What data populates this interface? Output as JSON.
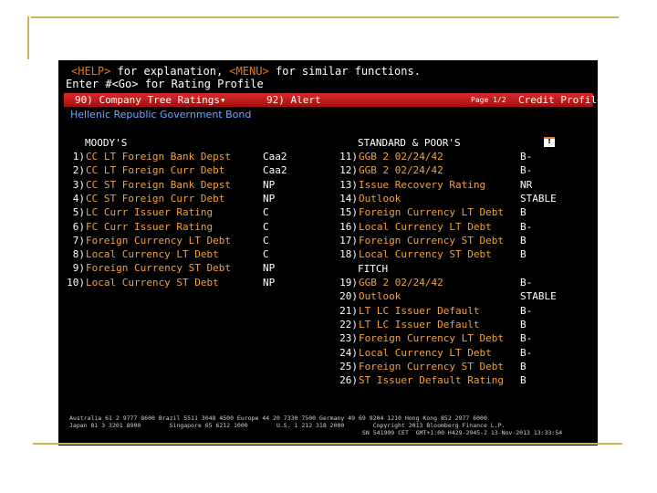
{
  "command": {
    "help_key": "<HELP>",
    "help_text": " for explanation, ",
    "menu_key": "<MENU>",
    "menu_text": " for similar functions.",
    "prompt": "Enter #<Go> for Rating Profile"
  },
  "toolbar": {
    "company_tree": "90) Company Tree Ratings▾",
    "alert": "92) Alert",
    "page": "Page 1/2",
    "title": "Credit Profile"
  },
  "security_name": "Hellenic Republic Government Bond",
  "moodys": {
    "header": "MOODY'S",
    "rows": [
      {
        "num": "1)",
        "label": "CC LT Foreign Bank Depst",
        "value": "Caa2"
      },
      {
        "num": "2)",
        "label": "CC LT Foreign Curr Debt",
        "value": "Caa2"
      },
      {
        "num": "3)",
        "label": "CC ST Foreign Bank Depst",
        "value": "NP"
      },
      {
        "num": "4)",
        "label": "CC ST Foreign Curr Debt",
        "value": "NP"
      },
      {
        "num": "5)",
        "label": "LC Curr Issuer Rating",
        "value": "C"
      },
      {
        "num": "6)",
        "label": "FC Curr Issuer Rating",
        "value": "C"
      },
      {
        "num": "7)",
        "label": "Foreign Currency LT Debt",
        "value": "C"
      },
      {
        "num": "8)",
        "label": "Local Currency LT Debt",
        "value": "C"
      },
      {
        "num": "9)",
        "label": "Foreign Currency ST Debt",
        "value": "NP"
      },
      {
        "num": "10)",
        "label": "Local Currency ST Debt",
        "value": "NP"
      }
    ]
  },
  "sp": {
    "header": "STANDARD & POOR'S",
    "rows": [
      {
        "num": "11)",
        "label": "GGB 2 02/24/42",
        "value": "B-"
      },
      {
        "num": "12)",
        "label": "GGB 2 02/24/42",
        "value": "B-"
      },
      {
        "num": "13)",
        "label": "Issue Recovery Rating",
        "value": "NR"
      },
      {
        "num": "14)",
        "label": "Outlook",
        "value": "STABLE"
      },
      {
        "num": "15)",
        "label": "Foreign Currency LT Debt",
        "value": "B"
      },
      {
        "num": "16)",
        "label": "Local Currency LT Debt",
        "value": "B-"
      },
      {
        "num": "17)",
        "label": "Foreign Currency ST Debt",
        "value": "B"
      },
      {
        "num": "18)",
        "label": "Local Currency ST Debt",
        "value": "B"
      }
    ]
  },
  "fitch": {
    "header": "FITCH",
    "rows": [
      {
        "num": "19)",
        "label": "GGB 2 02/24/42",
        "value": "B-"
      },
      {
        "num": "20)",
        "label": "Outlook",
        "value": "STABLE"
      },
      {
        "num": "21)",
        "label": "LT LC Issuer Default",
        "value": "B-"
      },
      {
        "num": "22)",
        "label": "LT LC Issuer Default",
        "value": "B"
      },
      {
        "num": "23)",
        "label": "Foreign Currency LT Debt",
        "value": "B-"
      },
      {
        "num": "24)",
        "label": "Local Currency LT Debt",
        "value": "B-"
      },
      {
        "num": "25)",
        "label": "Foreign Currency ST Debt",
        "value": "B"
      },
      {
        "num": "26)",
        "label": "ST Issuer Default Rating",
        "value": "B"
      }
    ]
  },
  "help_icon": "!",
  "footer": {
    "line1": "Australia 61 2 9777 8600 Brazil 5511 3048 4500 Europe 44 20 7330 7500 Germany 49 69 9204 1210 Hong Kong 852 2977 6000",
    "line2": "Japan 81 3 3201 8900        Singapore 65 6212 1000        U.S. 1 212 318 2000        Copyright 2013 Bloomberg Finance L.P.",
    "line3": "SN 541909 CET  GMT+1:00 H429-2945-2 13-Nov-2013 13:33:54"
  },
  "colors": {
    "terminal_bg": "#000000",
    "label_orange": "#f0a23c",
    "bar_red": "#c41c1c",
    "subtitle_blue": "#6fa8ff",
    "slide_gold": "#c9b458"
  }
}
